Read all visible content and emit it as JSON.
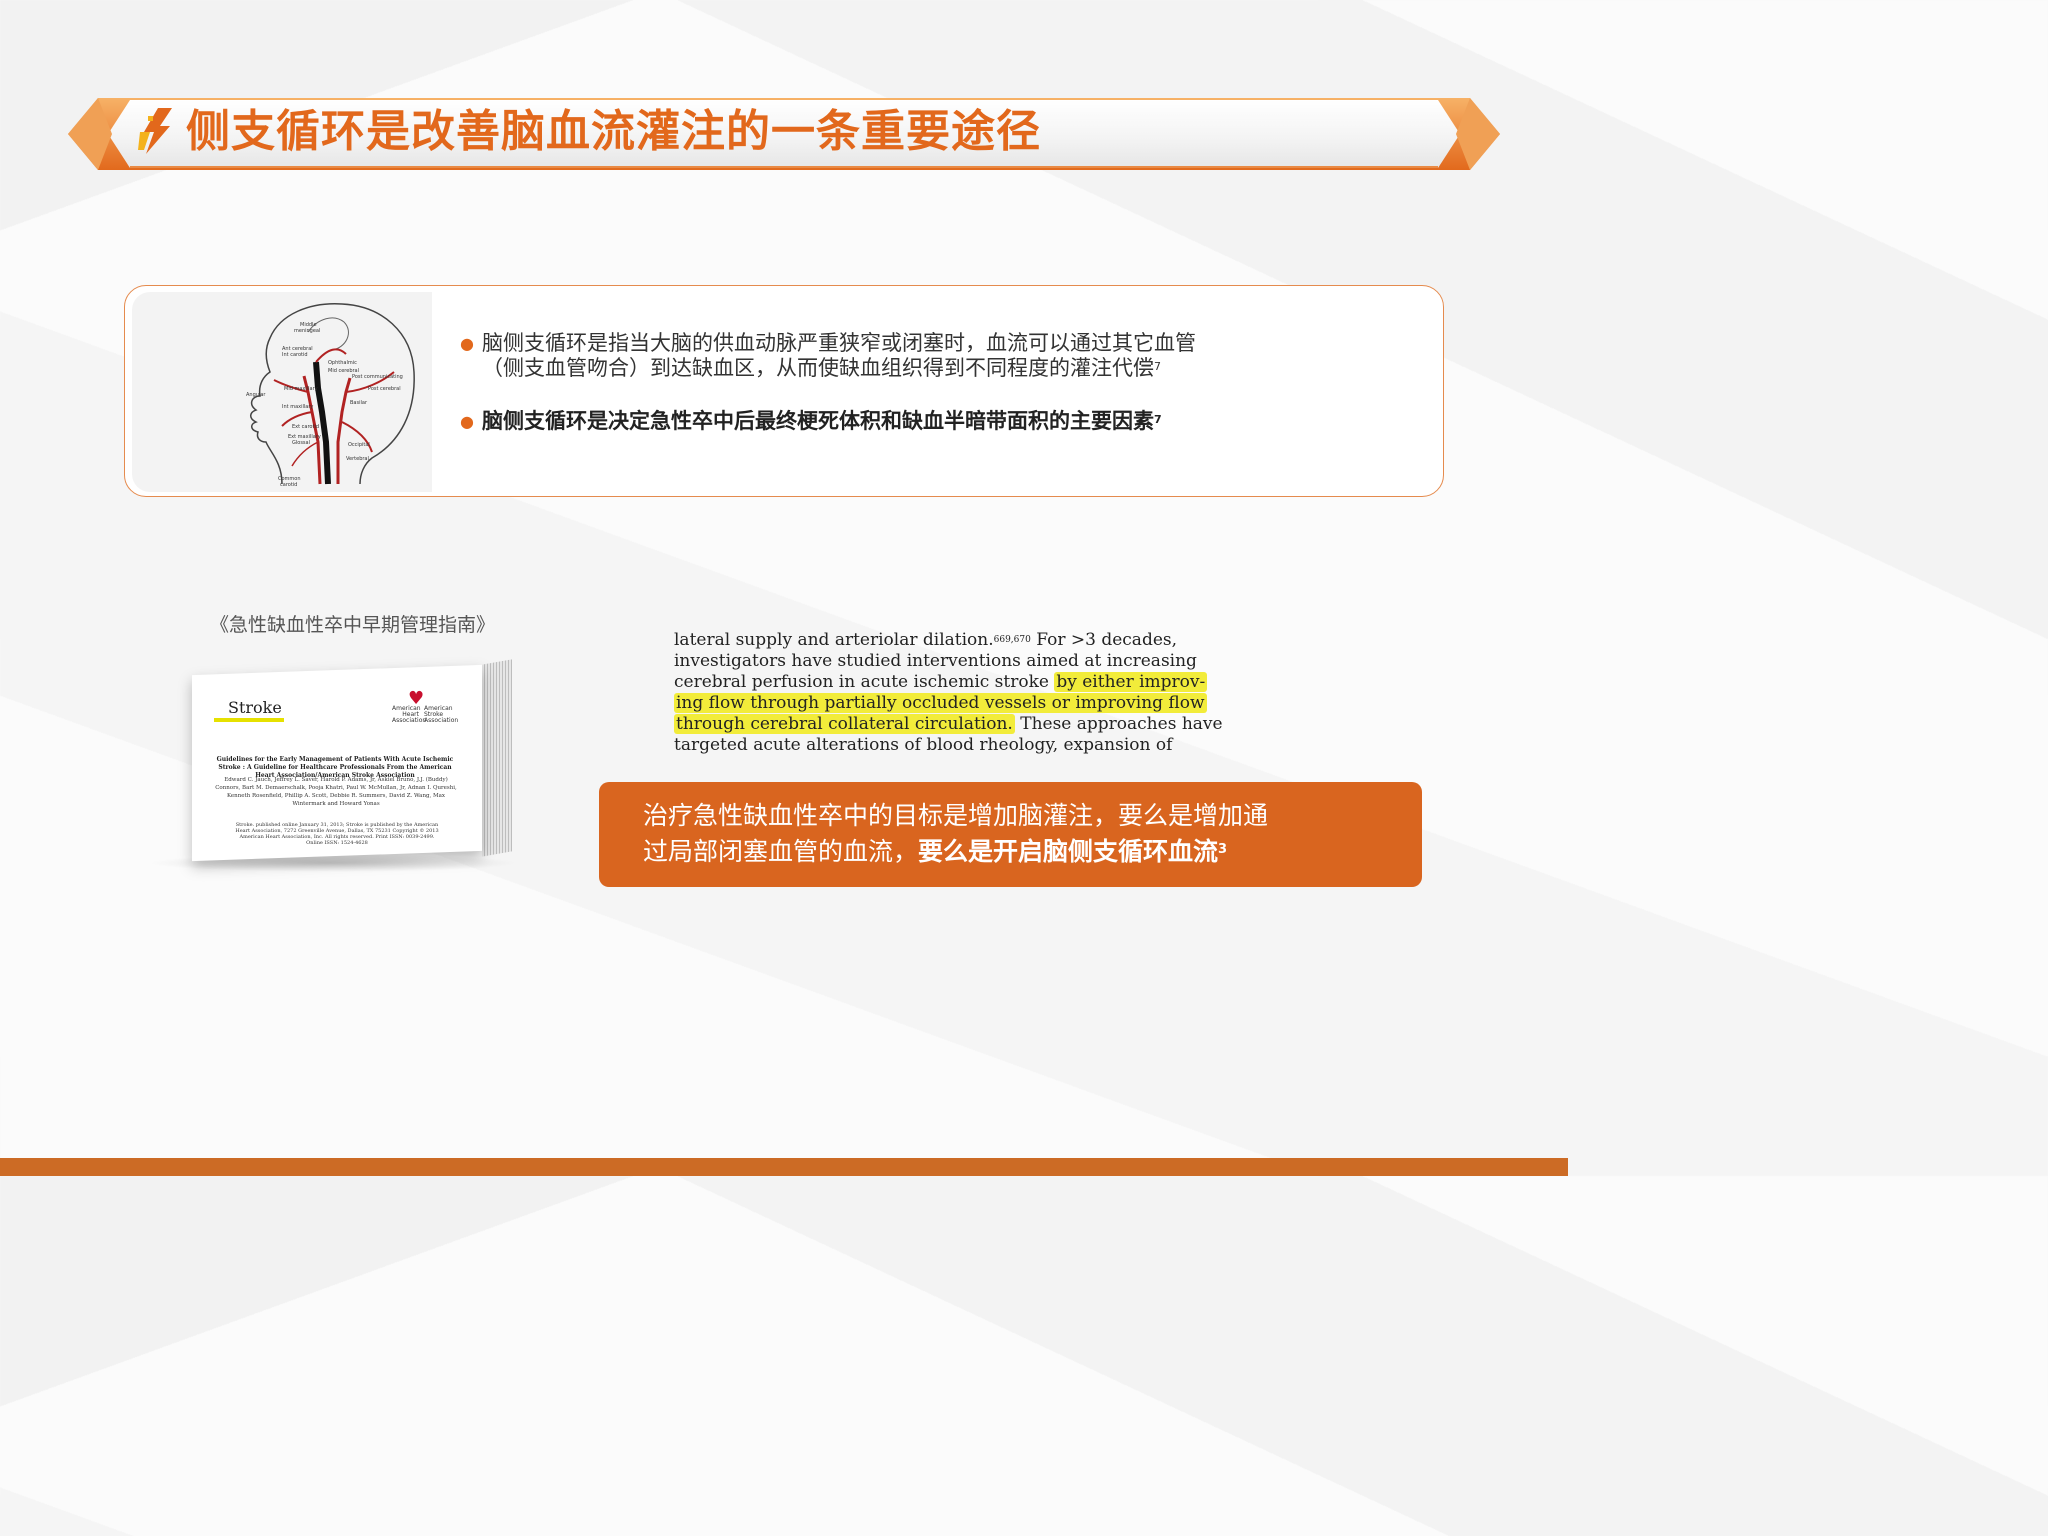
{
  "header": {
    "title": "侧支循环是改善脑血流灌注的一条重要途径"
  },
  "diagram": {
    "labels": [
      "Middle meningeal",
      "Ant cerebral Int carotid",
      "Ophthalmic",
      "Mid cerebral",
      "Post communicating",
      "Post cerebral",
      "Angular",
      "Mid maxillary",
      "Basilar",
      "Int maxillary",
      "Ext carotid",
      "Ext maxillary Glossal",
      "Occipital",
      "Vertebral",
      "Common carotid"
    ]
  },
  "bullets": [
    {
      "line1": "脑侧支循环是指当大脑的供血动脉严重狭窄或闭塞时，血流可以通过其它血管",
      "line2": "（侧支血管吻合）到达缺血区，从而使缺血组织得到不同程度的灌注代偿",
      "ref": "7"
    },
    {
      "text": "脑侧支循环是决定急性卒中后最终梗死体积和缺血半暗带面积的主要因素",
      "ref": "7"
    }
  ],
  "guideline": {
    "caption": "《急性缺血性卒中早期管理指南》",
    "journal": "Stroke",
    "aha_left": [
      "American",
      "Heart",
      "Association"
    ],
    "aha_right": [
      "American",
      "Stroke",
      "Association"
    ],
    "cover_title": "Guidelines for the Early Management of Patients With Acute Ischemic Stroke : A Guideline for Healthcare Professionals From the American Heart Association/American Stroke Association",
    "cover_authors": "Edward C. Jauch, Jeffrey L. Saver, Harold P. Adams, Jr, Askiel Bruno, J.J. (Buddy) Connors, Bart M. Demaerschalk, Pooja Khatri, Paul W. McMullan, Jr, Adnan I. Qureshi, Kenneth Rosenfield, Phillip A. Scott, Debbie R. Summers, David Z. Wang, Max Wintermark and Howard Yonas",
    "cover_pub": "Stroke. published online January 31, 2013; Stroke is published by the American Heart Association, 7272 Greenville Avenue, Dallas, TX 75231 Copyright © 2013 American Heart Association, Inc. All rights reserved. Print ISSN: 0039-2499. Online ISSN: 1524-4628"
  },
  "excerpt": {
    "l1a": "lateral supply and arteriolar dilation.",
    "l1ref": "669,670",
    "l1b": " For >3 decades,",
    "l2": "investigators have studied interventions aimed at increasing",
    "l3a": "cerebral perfusion in acute ischemic stroke ",
    "l3hl": "by either improv-",
    "l4hl": "ing flow through partially occluded vessels or improving flow",
    "l5hl": "through cerebral collateral circulation.",
    "l5b": " These approaches have",
    "l6": "targeted acute alterations of blood rheology, expansion of"
  },
  "callout": {
    "line1": "治疗急性缺血性卒中的目标是增加脑灌注，要么是增加通",
    "line2a": "过局部闭塞血管的血流，",
    "line2b": "要么是开启脑侧支循环血流",
    "ref": "3"
  },
  "colors": {
    "accent": "#e2681c",
    "callout_bg": "#d9651f",
    "highlight": "#f2ec3a",
    "footer": "#cc6b25"
  }
}
